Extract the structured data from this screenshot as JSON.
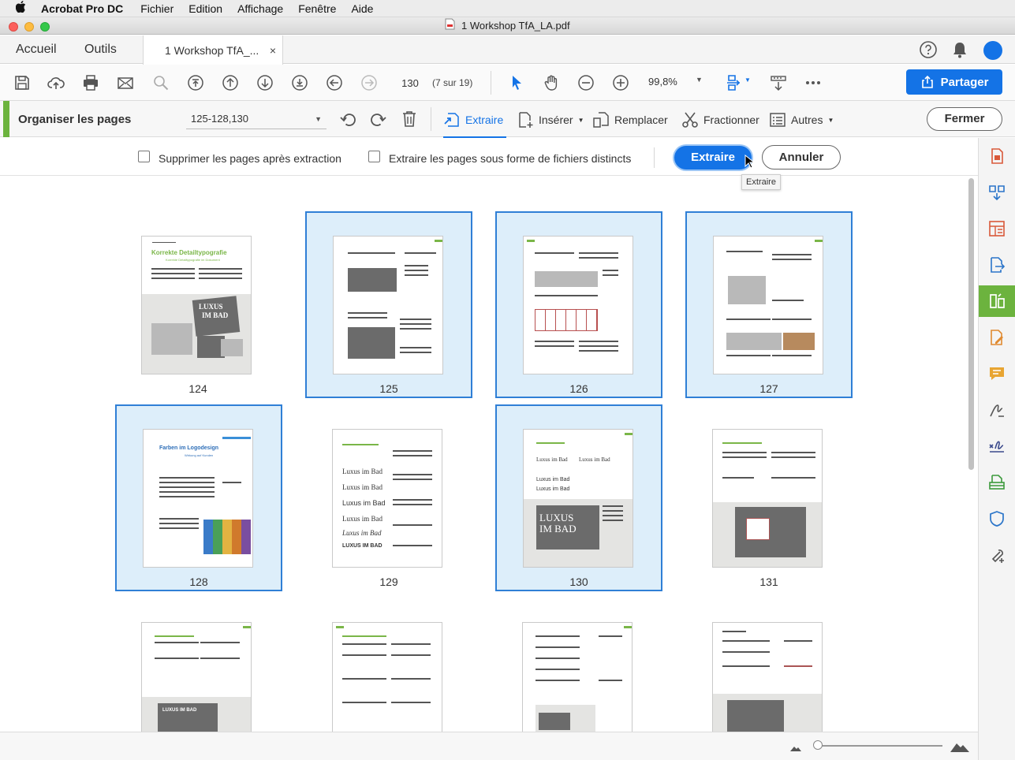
{
  "menubar": {
    "apple": "",
    "app_name": "Acrobat Pro DC",
    "items": [
      "Fichier",
      "Edition",
      "Affichage",
      "Fenêtre",
      "Aide"
    ]
  },
  "window": {
    "title": "1  Workshop TfA_LA.pdf"
  },
  "tabs": {
    "home": "Accueil",
    "tools": "Outils",
    "document": "1  Workshop TfA_...",
    "close_glyph": "×"
  },
  "toolbar": {
    "page_value": "130",
    "page_count": "(7 sur 19)",
    "zoom": "99,8%",
    "share": "Partager"
  },
  "organize": {
    "title": "Organiser les pages",
    "range": "125-128,130",
    "extract": "Extraire",
    "insert": "Insérer",
    "replace": "Remplacer",
    "split": "Fractionner",
    "more": "Autres",
    "close": "Fermer"
  },
  "extract_options": {
    "delete_after": "Supprimer les pages après extraction",
    "separate_files": "Extraire les pages sous forme de fichiers distincts",
    "extract_button": "Extraire",
    "cancel_button": "Annuler",
    "tooltip": "Extraire"
  },
  "thumb_texts": {
    "p124_title": "Korrekte Detailtypografie",
    "p124_sub": "Korrekte Detailtypografie im Dokument",
    "p124_luxus": "LUXUS",
    "p124_bad": "IM BAD",
    "p128_title": "Farben im Logodesign",
    "p128_sub": "Wirkung auf Kunden",
    "p129_lines": [
      "Luxus im Bad",
      "Luxus im Bad",
      "Luxus im Bad",
      "Luxus im Bad",
      "Luxus im Bad",
      "LUXUS IM BAD"
    ],
    "p130_a": "Luxus im Bad",
    "p130_b": "Luxus im Bad",
    "p130_c": "Luxus im Bad",
    "p130_d": "Luxus im Bad",
    "p130_luxus": "LUXUS",
    "p130_bad": "IM BAD",
    "p132_luxus": "LUXUS IM BAD"
  },
  "pages": [
    {
      "num": "124",
      "selected": false
    },
    {
      "num": "125",
      "selected": true
    },
    {
      "num": "126",
      "selected": true
    },
    {
      "num": "127",
      "selected": true
    },
    {
      "num": "128",
      "selected": true
    },
    {
      "num": "129",
      "selected": false
    },
    {
      "num": "130",
      "selected": true
    },
    {
      "num": "131",
      "selected": false
    }
  ],
  "colors": {
    "accent": "#1473e6",
    "selection_bg": "#ddeefa",
    "organize_green": "#6cb33e"
  }
}
